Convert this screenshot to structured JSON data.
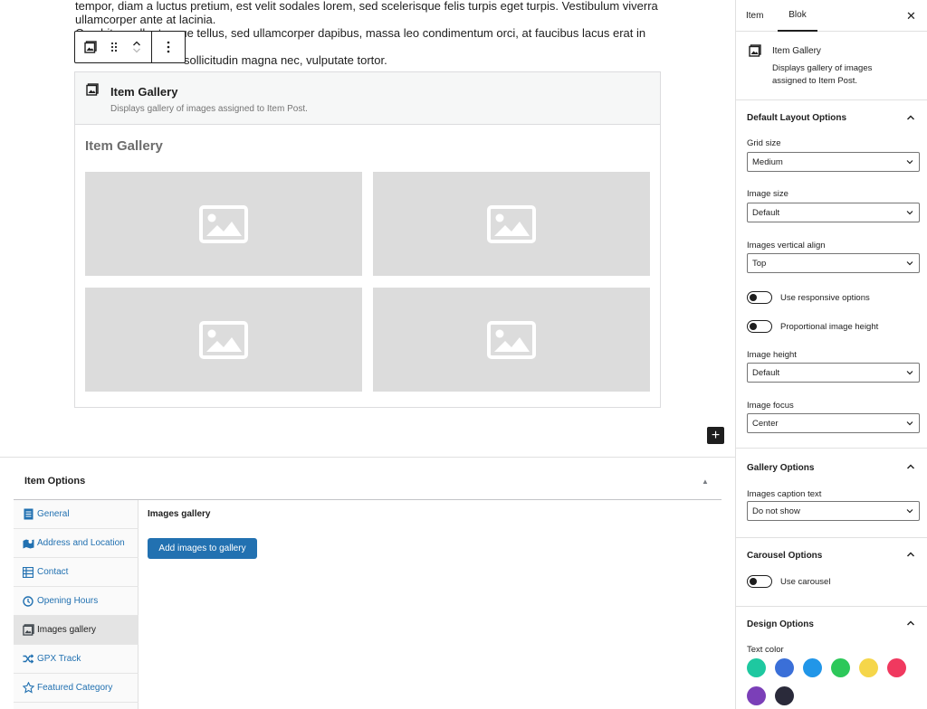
{
  "editor": {
    "paragraph": {
      "line1": "tempor, diam a luctus pretium, est velit sodales lorem, sed scelerisque felis turpis eget turpis. Vestibulum viverra",
      "line2": "ullamcorper ante at lacinia.",
      "line3": "Curabitur pellentesque tellus, sed ullamcorper dapibus, massa leo condimentum orci, at faucibus lacus erat in ante. Ut et",
      "line4": "sollicitudin magna nec, vulputate tortor."
    },
    "gallery_block": {
      "title": "Item Gallery",
      "description": "Displays gallery of images assigned to Item Post.",
      "preview_heading": "Item Gallery"
    },
    "add_block_glyph": "+"
  },
  "item_options": {
    "title": "Item Options",
    "collapse_glyph": "▲",
    "tabs": [
      {
        "label": "General",
        "icon": "document-icon"
      },
      {
        "label": "Address and Location",
        "icon": "map-icon"
      },
      {
        "label": "Contact",
        "icon": "table-icon"
      },
      {
        "label": "Opening Hours",
        "icon": "clock-icon"
      },
      {
        "label": "Images gallery",
        "icon": "gallery-icon"
      },
      {
        "label": "GPX Track",
        "icon": "shuffle-icon"
      },
      {
        "label": "Featured Category",
        "icon": "star-icon"
      }
    ],
    "active_tab": "Images gallery",
    "content": {
      "heading": "Images gallery",
      "add_button": "Add images to gallery"
    }
  },
  "sidebar": {
    "tabs": {
      "item": "Item",
      "blok": "Blok"
    },
    "close_glyph": "✕",
    "block_card": {
      "name": "Item Gallery",
      "description": "Displays gallery of images assigned to Item Post."
    },
    "default_layout": {
      "title": "Default Layout Options",
      "grid_size": {
        "label": "Grid size",
        "value": "Medium"
      },
      "image_size": {
        "label": "Image size",
        "value": "Default"
      },
      "vertical_align": {
        "label": "Images vertical align",
        "value": "Top"
      },
      "responsive": {
        "label": "Use responsive options",
        "on": false
      },
      "proportional": {
        "label": "Proportional image height",
        "on": false
      },
      "image_height": {
        "label": "Image height",
        "value": "Default"
      },
      "image_focus": {
        "label": "Image focus",
        "value": "Center"
      }
    },
    "gallery_options": {
      "title": "Gallery Options",
      "caption": {
        "label": "Images caption text",
        "value": "Do not show"
      }
    },
    "carousel_options": {
      "title": "Carousel Options",
      "carousel": {
        "label": "Use carousel",
        "on": false
      }
    },
    "design_options": {
      "title": "Design Options",
      "text_color_label": "Text color",
      "colors": [
        "#1ec8a0",
        "#3a6fd8",
        "#2196e8",
        "#2dc85a",
        "#f5d64a",
        "#f0395f",
        "#7b3fb8",
        "#2a2a3a"
      ]
    }
  }
}
